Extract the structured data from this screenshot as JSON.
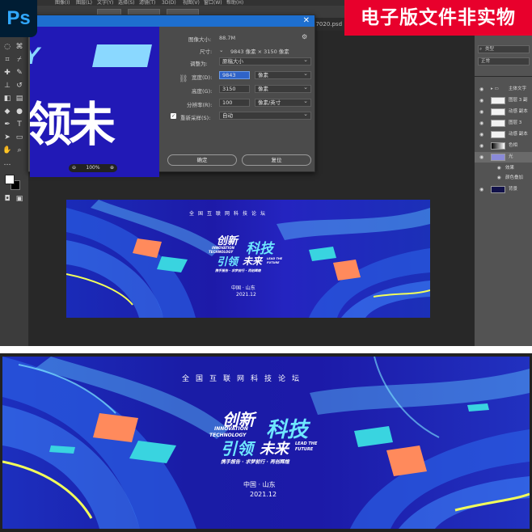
{
  "app": {
    "logo": "Ps"
  },
  "menubar": [
    "图像(I)",
    "图层(L)",
    "文字(Y)",
    "选择(S)",
    "滤镜(T)",
    "3D(D)",
    "视图(V)",
    "窗口(W)",
    "帮助(H)"
  ],
  "tab": {
    "filename": "17020.psd"
  },
  "watermark": "电子版文件非实物",
  "dialog": {
    "image_size_label": "图像大小:",
    "image_size_value": "88.7M",
    "dimensions_label": "尺寸:",
    "dimensions_value": "9843 像素 × 3150 像素",
    "fit_label": "调整为:",
    "fit_value": "原稿大小",
    "width_label": "宽度(D):",
    "width_value": "9843",
    "width_unit": "像素",
    "height_label": "高度(G):",
    "height_value": "3150",
    "height_unit": "像素",
    "resolution_label": "分辨率(R):",
    "resolution_value": "100",
    "resolution_unit": "像素/英寸",
    "resample_label": "重新采样(S):",
    "resample_value": "自动",
    "resample_checked": true,
    "ok_label": "确定",
    "reset_label": "复位",
    "zoom_value": "100%",
    "preview_text_top": "Y",
    "preview_text_big": "领未"
  },
  "layers": {
    "search_placeholder": "类型",
    "blend_mode": "正常",
    "items": [
      {
        "name": "主体文字",
        "type": "group"
      },
      {
        "name": "图层 3 副",
        "type": "layer"
      },
      {
        "name": "动感 副本",
        "type": "layer"
      },
      {
        "name": "图层 3",
        "type": "layer"
      },
      {
        "name": "动感 副本",
        "type": "layer"
      },
      {
        "name": "色相",
        "type": "layer"
      },
      {
        "name": "光",
        "type": "layer"
      },
      {
        "name": "效果",
        "type": "effect"
      },
      {
        "name": "颜色叠加",
        "type": "effect"
      },
      {
        "name": "背景",
        "type": "layer"
      }
    ]
  },
  "banner": {
    "subtitle": "全国互联网科技论坛",
    "title_white_1": "创新",
    "title_cyan_1": "科技",
    "title_small_en_1": "INNOVATION",
    "title_small_en_2": "TECHNOLOGY",
    "title_cyan_2": "引领",
    "title_white_2": "未来",
    "lead_en_1": "LEAD THE",
    "lead_en_2": "FUTURE",
    "slogan": "携手报告 · 求梦前行 · 再创辉煌",
    "location": "中国 · 山东",
    "date": "2021.12"
  },
  "colors": {
    "banner_bg": "#1c1aa8",
    "accent_cyan": "#6fe7ff",
    "accent_orange": "#ff8a5c",
    "ps_blue": "#31a8ff",
    "dialog_title": "#1e6fcf",
    "watermark_red": "#e8002c"
  }
}
